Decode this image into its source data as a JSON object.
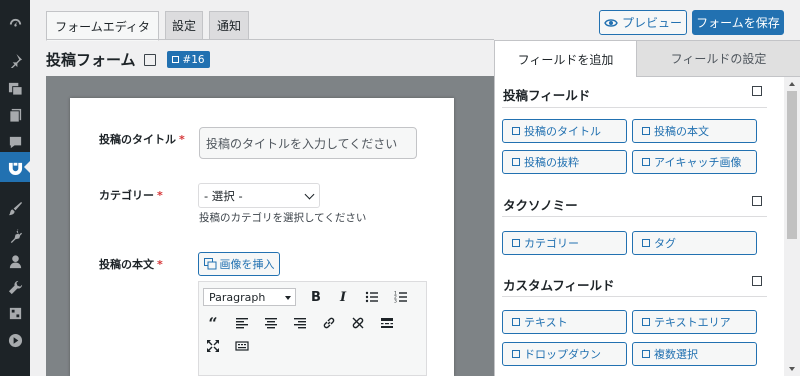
{
  "sidebar": {
    "icons": [
      "dashboard-icon",
      "pin-icon",
      "media-icon",
      "pages-icon",
      "comments-icon",
      "form-plugin-icon",
      "appearance-icon",
      "plugins-icon",
      "users-icon",
      "tools-icon",
      "settings-icon",
      "play-icon"
    ],
    "active_index": 5
  },
  "tabs": [
    {
      "label": "フォームエディタ",
      "active": true
    },
    {
      "label": "設定",
      "active": false
    },
    {
      "label": "通知",
      "active": false
    }
  ],
  "header": {
    "preview_label": "プレビュー",
    "save_label": "フォームを保存",
    "form_title": "投稿フォーム",
    "form_id": "#16"
  },
  "form": {
    "title_field": {
      "label": "投稿のタイトル",
      "required_mark": "*",
      "placeholder": "投稿のタイトルを入力してください"
    },
    "category_field": {
      "label": "カテゴリー",
      "required_mark": "*",
      "selected": "- 選択 -",
      "help": "投稿のカテゴリを選択してください"
    },
    "content_field": {
      "label": "投稿の本文",
      "required_mark": "*",
      "insert_image_label": "画像を挿入"
    },
    "editor": {
      "format_value": "Paragraph"
    }
  },
  "right_panel": {
    "tabs": [
      {
        "label": "フィールドを追加",
        "active": true
      },
      {
        "label": "フィールドの設定",
        "active": false
      }
    ],
    "sections": [
      {
        "title": "投稿フィールド",
        "buttons": [
          "投稿のタイトル",
          "投稿の本文",
          "投稿の抜粋",
          "アイキャッチ画像"
        ]
      },
      {
        "title": "タクソノミー",
        "buttons": [
          "カテゴリー",
          "タグ"
        ]
      },
      {
        "title": "カスタムフィールド",
        "buttons": [
          "テキスト",
          "テキストエリア",
          "ドロップダウン",
          "複数選択"
        ]
      }
    ]
  },
  "colors": {
    "accent": "#2271b1",
    "sidebar_bg": "#1d2327",
    "required": "#d63638",
    "canvas_bg": "#7e8386"
  }
}
